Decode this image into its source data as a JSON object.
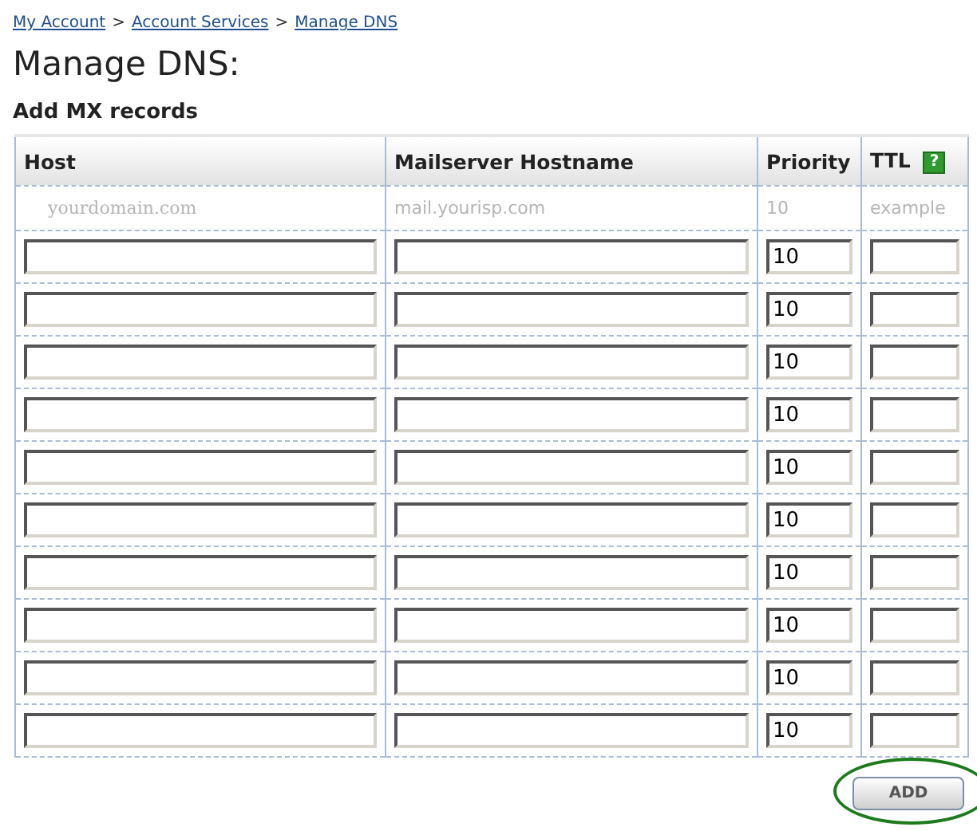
{
  "breadcrumb": [
    {
      "label": "My Account"
    },
    {
      "label": "Account Services"
    },
    {
      "label": "Manage DNS"
    }
  ],
  "breadcrumb_separator": ">",
  "title": "Manage DNS:",
  "subtitle": "Add MX records",
  "table": {
    "columns": [
      {
        "label": "Host"
      },
      {
        "label": "Mailserver Hostname"
      },
      {
        "label": "Priority"
      },
      {
        "label": "TTL",
        "help": "?"
      }
    ],
    "example": [
      "yourdomain.com",
      "mail.yourisp.com",
      "10",
      "example"
    ],
    "rows": [
      {
        "priority": "10"
      },
      {
        "priority": "10"
      },
      {
        "priority": "10"
      },
      {
        "priority": "10"
      },
      {
        "priority": "10"
      },
      {
        "priority": "10"
      },
      {
        "priority": "10"
      },
      {
        "priority": "10"
      },
      {
        "priority": "10"
      },
      {
        "priority": "10"
      }
    ]
  },
  "add_button": {
    "label": "ADD",
    "highlighted": true
  }
}
